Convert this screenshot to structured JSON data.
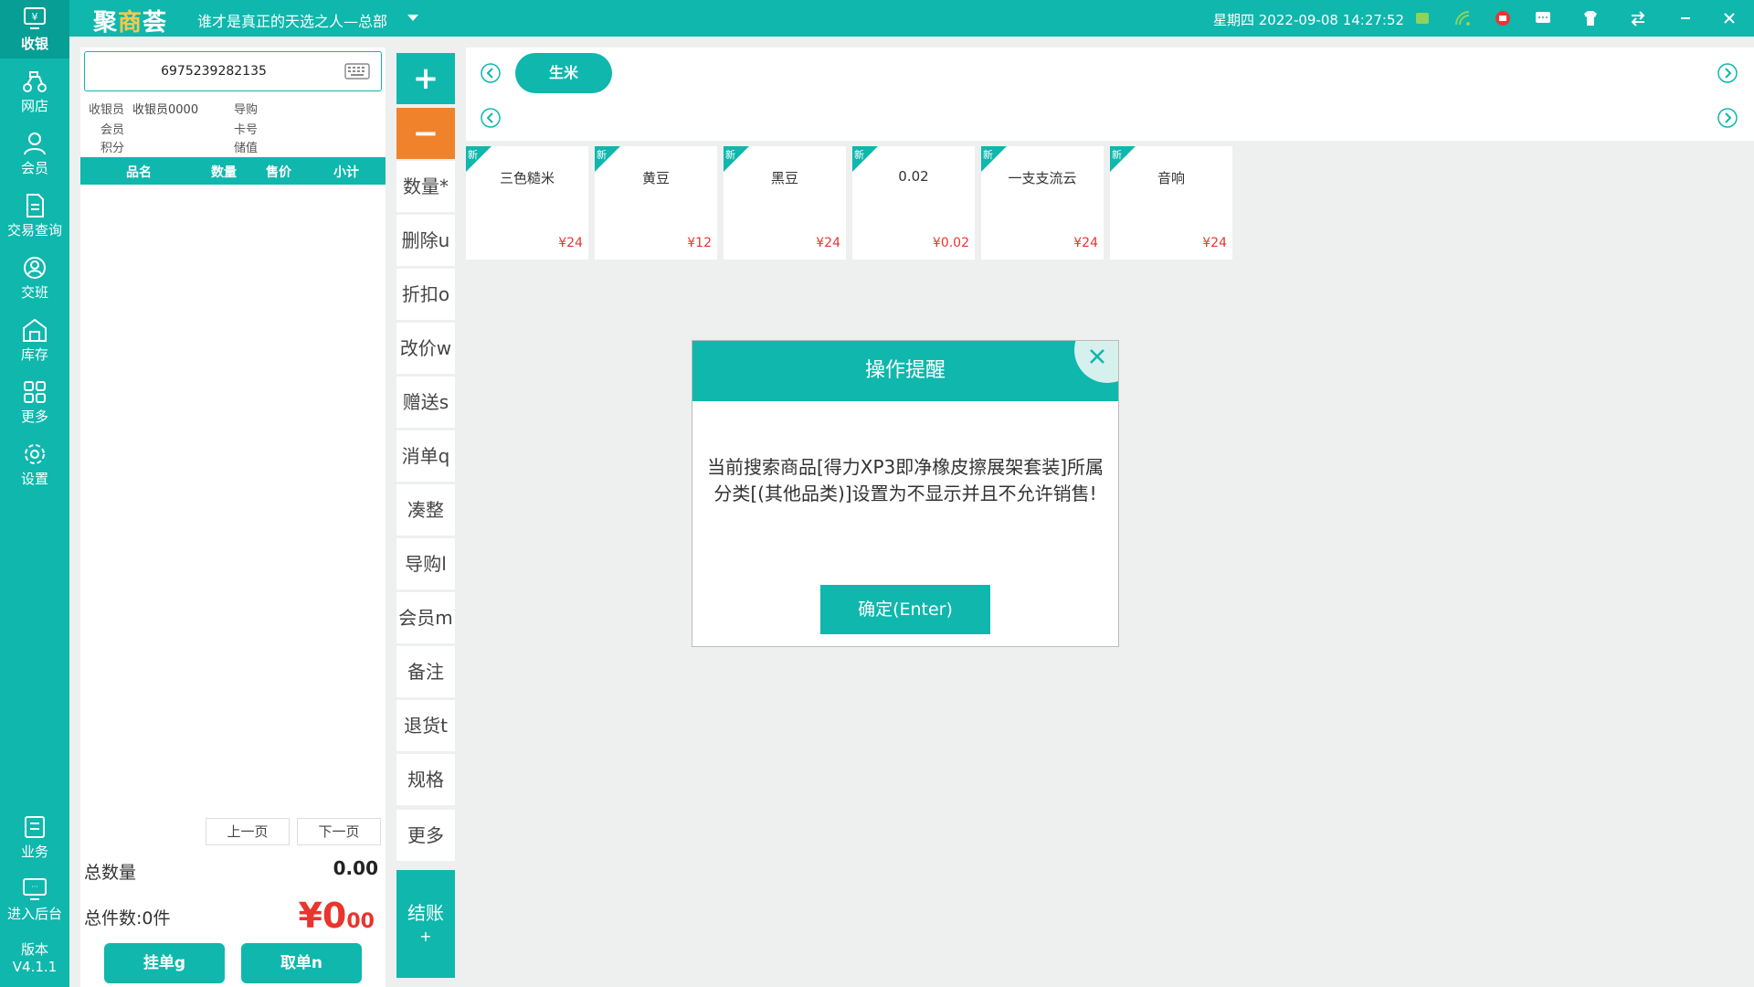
{
  "nav": {
    "items": [
      {
        "label": "收银",
        "icon": "cashier-icon"
      },
      {
        "label": "网店",
        "icon": "scooter-icon"
      },
      {
        "label": "会员",
        "icon": "member-icon"
      },
      {
        "label": "交易查询",
        "icon": "document-icon"
      },
      {
        "label": "交班",
        "icon": "shift-icon"
      },
      {
        "label": "库存",
        "icon": "warehouse-icon"
      },
      {
        "label": "更多",
        "icon": "grid-icon"
      },
      {
        "label": "设置",
        "icon": "gear-icon"
      },
      {
        "label": "业务",
        "icon": "business-icon"
      },
      {
        "label": "进入后台",
        "icon": "monitor-icon"
      }
    ],
    "version_label": "版本",
    "version_value": "V4.1.1"
  },
  "topbar": {
    "logo_part1": "聚",
    "logo_part2": "商",
    "logo_part3": "荟",
    "store": "谁才是真正的天选之人—总部",
    "datetime": "星期四 2022-09-08 14:27:52"
  },
  "order": {
    "scan_value": "6975239282135",
    "cashier_label": "收银员",
    "cashier_value": "收银员0000",
    "guide_label": "导购",
    "member_label": "会员",
    "card_label": "卡号",
    "points_label": "积分",
    "balance_label": "储值",
    "columns": [
      "品名",
      "数量",
      "售价",
      "小计"
    ],
    "prev_page": "上一页",
    "next_page": "下一页",
    "total_qty_label": "总数量",
    "total_qty_value": "0.00",
    "item_count_label": "总件数:0件",
    "amount_symbol": "¥",
    "amount_int": "0",
    "amount_dec": "00",
    "hold_button": "挂单g",
    "retrieve_button": "取单n"
  },
  "functions": {
    "plus": "+",
    "minus": "−",
    "items": [
      "数量*",
      "删除u",
      "折扣o",
      "改价w",
      "赠送s",
      "消单q",
      "凑整",
      "导购l",
      "会员m",
      "备注",
      "退货t",
      "规格",
      "更多"
    ],
    "checkout_label": "结账",
    "checkout_plus": "+"
  },
  "category": {
    "active": "生米"
  },
  "products": [
    {
      "name": "三色糙米",
      "price": "¥24",
      "tag": "新"
    },
    {
      "name": "黄豆",
      "price": "¥12",
      "tag": "新"
    },
    {
      "name": "黑豆",
      "price": "¥24",
      "tag": "新"
    },
    {
      "name": "0.02",
      "price": "¥0.02",
      "tag": "新"
    },
    {
      "name": "一支支流云",
      "price": "¥24",
      "tag": "新"
    },
    {
      "name": "音响",
      "price": "¥24",
      "tag": "新"
    }
  ],
  "dialog": {
    "title": "操作提醒",
    "message": "当前搜索商品[得力XP3即净橡皮擦展架套装]所属分类[(其他品类)]设置为不显示并且不允许销售!",
    "ok": "确定(Enter)"
  },
  "colors": {
    "primary": "#0fb7ad",
    "orange": "#f0822c",
    "price_red": "#e8352e"
  }
}
